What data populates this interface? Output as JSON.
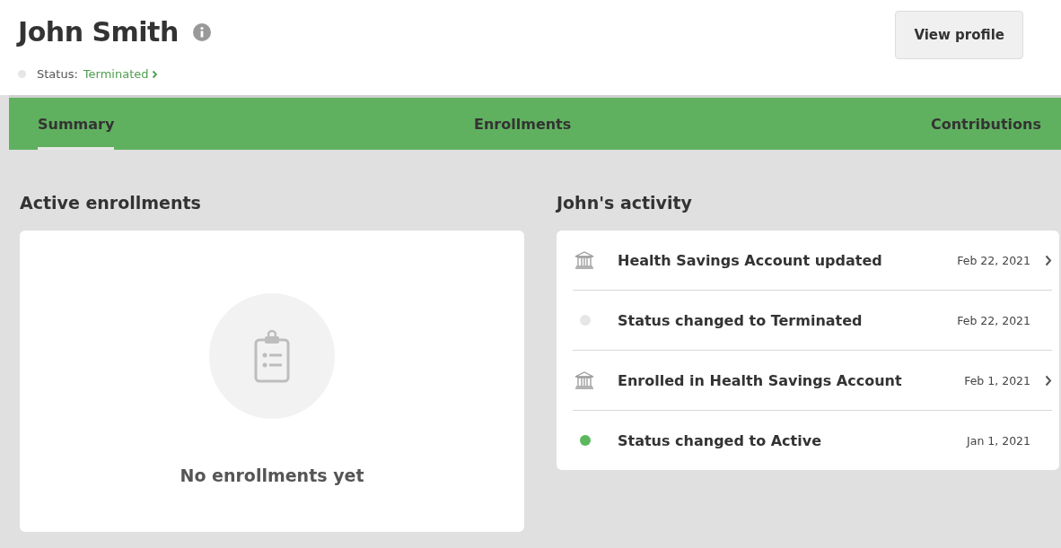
{
  "header": {
    "name": "John Smith",
    "button": "View profile",
    "status_label": "Status:",
    "status_value": "Terminated",
    "status_dot": {
      "color": "#e6e6e6"
    }
  },
  "tabs": [
    {
      "label": "Summary",
      "selected": true
    },
    {
      "label": "Enrollments",
      "selected": false
    },
    {
      "label": "Contributions",
      "selected": false
    }
  ],
  "enrollments": {
    "title": "Active enrollments",
    "empty_text": "No enrollments yet"
  },
  "activity": {
    "title": "John's activity",
    "items": [
      {
        "kind": "bank",
        "text": "Health Savings Account updated",
        "date": "Feb 22, 2021",
        "link": true
      },
      {
        "kind": "dot",
        "color": "#e6e6e6",
        "text": "Status changed to Terminated",
        "date": "Feb 22, 2021",
        "link": false
      },
      {
        "kind": "bank",
        "text": "Enrolled in Health Savings Account",
        "date": "Feb 1, 2021",
        "link": true
      },
      {
        "kind": "dot",
        "color": "#5cb85c",
        "text": "Status changed to Active",
        "date": "Jan 1, 2021",
        "link": false
      }
    ]
  }
}
